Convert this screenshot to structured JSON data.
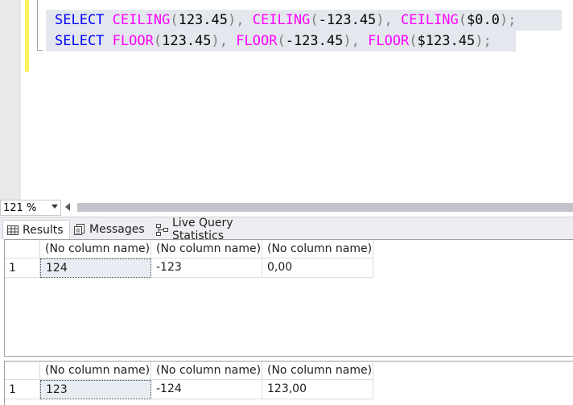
{
  "editor": {
    "line1": {
      "select": "SELECT",
      "f1": "CEILING",
      "open1": "(",
      "arg1": "123.45",
      "close1": ")",
      "comma1": ", ",
      "f2": "CEILING",
      "open2": "(",
      "arg2": "-123.45",
      "close2": ")",
      "comma2": ", ",
      "f3": "CEILING",
      "open3": "(",
      "arg3": "$0.0",
      "close3": ")",
      "semi": ";"
    },
    "line2": {
      "select": "SELECT",
      "f1": "FLOOR",
      "open1": "(",
      "arg1": "123.45",
      "close1": ")",
      "comma1": ", ",
      "f2": "FLOOR",
      "open2": "(",
      "arg2": "-123.45",
      "close2": ")",
      "comma2": ", ",
      "f3": "FLOOR",
      "open3": "(",
      "arg3": "$123.45",
      "close3": ")",
      "semi": ";"
    }
  },
  "zoom": {
    "value": "121 %"
  },
  "tabs": {
    "results": "Results",
    "messages": "Messages",
    "live_query_statistics": "Live Query Statistics"
  },
  "grid1": {
    "columns": [
      "(No column name)",
      "(No column name)",
      "(No column name)"
    ],
    "rows": [
      {
        "num": "1",
        "cells": [
          "124",
          "-123",
          "0,00"
        ]
      }
    ]
  },
  "grid2": {
    "columns": [
      "(No column name)",
      "(No column name)",
      "(No column name)"
    ],
    "rows": [
      {
        "num": "1",
        "cells": [
          "123",
          "-124",
          "123,00"
        ]
      }
    ]
  },
  "colors": {
    "keyword": "#0000ff",
    "function": "#ff00ff",
    "operator": "#808080",
    "change_bar": "#fff45a",
    "selected_line": "#e4e8ee"
  }
}
